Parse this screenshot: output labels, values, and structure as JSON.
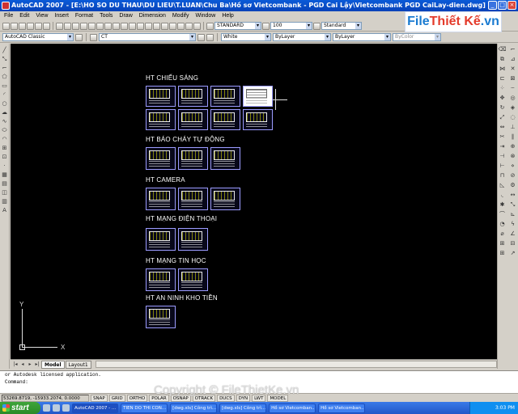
{
  "window": {
    "title": "AutoCAD 2007 - [E:\\HO SO DU THAU\\DU LIEU\\T.LUAN\\Chu Ba\\Hồ sơ Vietcombank - PGD Cai Lậy\\Vietcombank PGD CaiLay-dien.dwg]"
  },
  "logo": {
    "part1": "File",
    "part2": "Thiết Kế",
    "part3": ".vn"
  },
  "menu": [
    "File",
    "Edit",
    "View",
    "Insert",
    "Format",
    "Tools",
    "Draw",
    "Dimension",
    "Modify",
    "Window",
    "Help"
  ],
  "toolbar": {
    "workspace": "AutoCAD Classic",
    "layer": "CT",
    "color": "White",
    "linetype": "ByLayer",
    "lineweight": "ByLayer",
    "plotstyle": "ByColor",
    "textstyle": "STANDARD",
    "dimscale": "100",
    "dimstyle": "Standard"
  },
  "drawing": {
    "groups": [
      {
        "title": "HT CHIẾU SÁNG",
        "sheet_count": 8,
        "columns": 4
      },
      {
        "title": "HT BÁO CHÁY TỰ ĐỘNG",
        "sheet_count": 3,
        "columns": 3
      },
      {
        "title": "HT CAMERA",
        "sheet_count": 3,
        "columns": 3
      },
      {
        "title": "HT MẠNG ĐIỆN THOẠI",
        "sheet_count": 2,
        "columns": 2
      },
      {
        "title": "HT MẠNG TIN HỌC",
        "sheet_count": 2,
        "columns": 2
      },
      {
        "title": "HT AN NINH KHO TIỀN",
        "sheet_count": 1,
        "columns": 1
      }
    ],
    "ucs_x": "X",
    "ucs_y": "Y"
  },
  "layout_tabs": [
    "Model",
    "Layout1"
  ],
  "active_tab": "Model",
  "command": {
    "history": "or Autodesk licensed application.",
    "prompt": "Command:"
  },
  "status": {
    "coords": "53269.8719, -15933.2074, 0.0000",
    "buttons": [
      "SNAP",
      "GRID",
      "ORTHO",
      "POLAR",
      "OSNAP",
      "OTRACK",
      "DUCS",
      "DYN",
      "LWT",
      "MODEL"
    ]
  },
  "taskbar": {
    "start": "start",
    "tasks": [
      "AutoCAD 2007 - ...",
      "TIEN DO THI CON...",
      "[dwg.xls] Công trì...",
      "[dwg.xls] Công trì...",
      "Hồ sơ Vietcomban...",
      "Hồ sơ Vietcomban..."
    ],
    "clock": "3:03 PM"
  },
  "watermark": "Copyright © FileThietKe.vn"
}
